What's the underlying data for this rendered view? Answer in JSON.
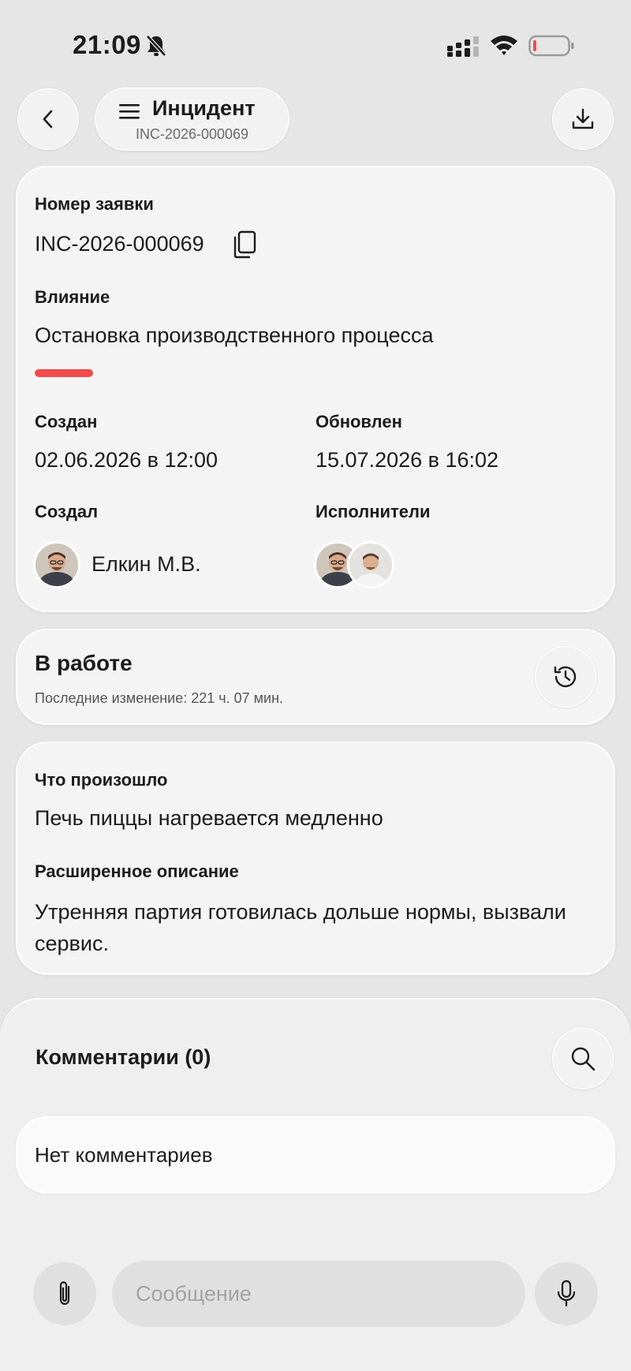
{
  "status_bar": {
    "time": "21:09"
  },
  "header": {
    "title": "Инцидент",
    "subtitle": "INC-2026-000069"
  },
  "ticket": {
    "number_label": "Номер заявки",
    "number_value": "INC-2026-000069",
    "impact_label": "Влияние",
    "impact_value": "Остановка производственного процесса",
    "impact_color": "#f24b4b",
    "created_label": "Создан",
    "created_value": "02.06.2026 в 12:00",
    "updated_label": "Обновлен",
    "updated_value": "15.07.2026 в 16:02",
    "author_label": "Создал",
    "author_name": "Елкин М.В.",
    "assignees_label": "Исполнители"
  },
  "status": {
    "title": "В работе",
    "last_change": "Последние изменение: 221 ч. 07 мин."
  },
  "description": {
    "what_label": "Что произошло",
    "what_value": "Печь пиццы нагревается медленно",
    "extended_label": "Расширенное описание",
    "extended_value": "Утренняя партия готовилась дольше нормы, вызвали сервис."
  },
  "comments": {
    "title": "Комментарии (0)",
    "empty_text": "Нет комментариев",
    "message_placeholder": "Сообщение"
  }
}
